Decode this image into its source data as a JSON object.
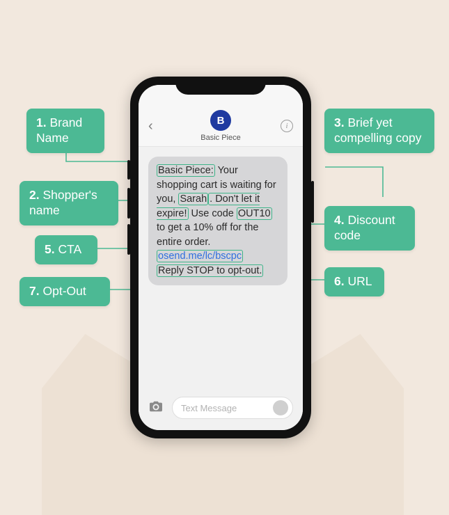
{
  "contact": {
    "initial": "B",
    "name": "Basic Piece"
  },
  "message": {
    "brand": "Basic Piece:",
    "copy_before_name": " Your shopping cart is waiting for you, ",
    "shopper_name": "Sarah",
    "copy_mid": ". Don't let it expire!",
    "discount_sentence_pre": " Use code ",
    "discount_code": "OUT10",
    "discount_sentence_post": " to get a 10% off for the entire order. ",
    "url": "osend.me/lc/bscpc",
    "opt_out": "Reply STOP to opt-out."
  },
  "compose": {
    "placeholder": "Text Message"
  },
  "callouts": {
    "c1": {
      "num": "1.",
      "text": "Brand Name"
    },
    "c2": {
      "num": "2.",
      "text": "Shopper's name"
    },
    "c3": {
      "num": "3.",
      "text": "Brief yet compelling copy"
    },
    "c4": {
      "num": "4.",
      "text": "Discount code"
    },
    "c5": {
      "num": "5.",
      "text": "CTA"
    },
    "c6": {
      "num": "6.",
      "text": "URL"
    },
    "c7": {
      "num": "7.",
      "text": "Opt-Out"
    }
  }
}
